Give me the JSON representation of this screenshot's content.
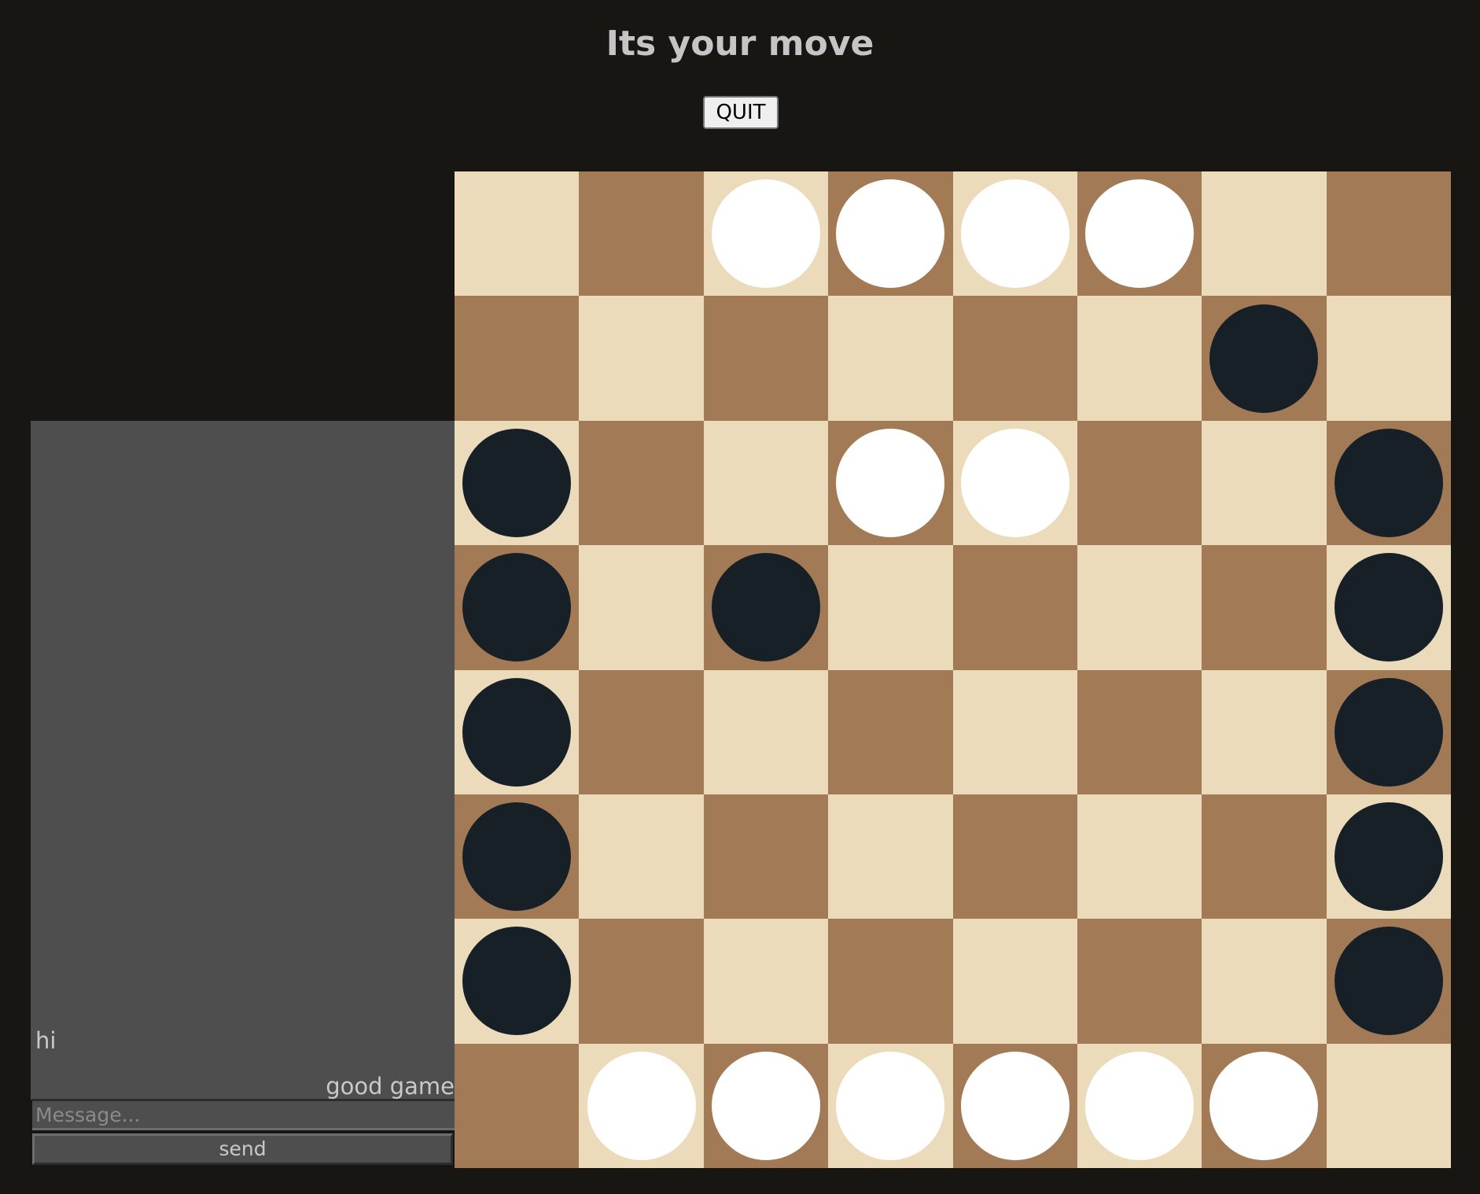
{
  "header": {
    "status": "Its your move",
    "quit_label": "QUIT"
  },
  "chat": {
    "messages": [
      {
        "text": "hi",
        "side": "left"
      },
      {
        "text": "good game",
        "side": "right"
      }
    ],
    "input_placeholder": "Message...",
    "send_label": "send"
  },
  "board": {
    "size": 8,
    "colors": {
      "light": "#ecdbbb",
      "dark": "#a37a56",
      "white_piece": "#ffffff",
      "black_piece": "#182027",
      "page_background": "#171613",
      "chat_background": "#4e4e4e"
    },
    "rows": [
      "..wwww..",
      "......b.",
      "b..ww..b",
      "b.b....b",
      "b......b",
      "b......b",
      "b......b",
      ".wwwwww."
    ]
  }
}
